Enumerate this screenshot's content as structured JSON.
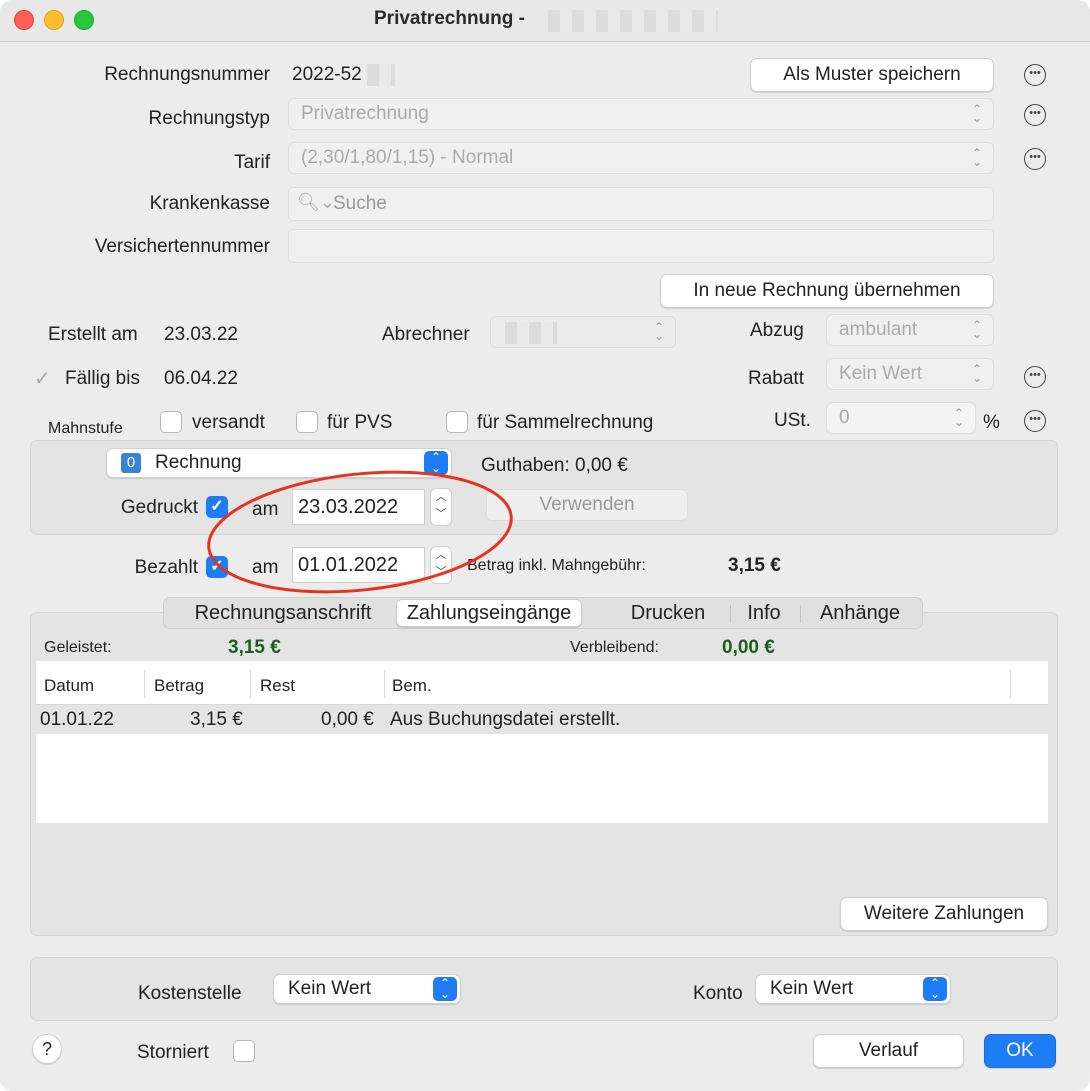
{
  "window": {
    "title": "Privatrechnung -"
  },
  "header": {
    "rechnungsnummer_label": "Rechnungsnummer",
    "rechnungsnummer_value": "2022-52",
    "save_pattern_button": "Als Muster speichern",
    "rechnungstyp_label": "Rechnungstyp",
    "rechnungstyp_value": "Privatrechnung",
    "tarif_label": "Tarif",
    "tarif_value": "(2,30/1,80/1,15) - Normal",
    "krankenkasse_label": "Krankenkasse",
    "krankenkasse_placeholder": "Suche",
    "versichertennummer_label": "Versichertennummer",
    "transfer_button": "In neue Rechnung übernehmen"
  },
  "details": {
    "erstellt_label": "Erstellt am",
    "erstellt_value": "23.03.22",
    "abrechner_label": "Abrechner",
    "abzug_label": "Abzug",
    "abzug_value": "ambulant",
    "faellig_label": "Fällig bis",
    "faellig_value": "06.04.22",
    "rabatt_label": "Rabatt",
    "rabatt_value": "Kein Wert",
    "mahnstufe_label": "Mahnstufe",
    "versandt_label": "versandt",
    "pvs_label": "für PVS",
    "sammel_label": "für Sammelrechnung",
    "ust_label": "USt.",
    "ust_value": "0",
    "percent": "%"
  },
  "status": {
    "badge": "0",
    "rechnung_value": "Rechnung",
    "guthaben": "Guthaben: 0,00 €",
    "gedruckt_label": "Gedruckt",
    "am_label": "am",
    "gedruckt_date": "23.03.2022",
    "verwenden_button": "Verwenden",
    "bezahlt_label": "Bezahlt",
    "bezahlt_date": "01.01.2022",
    "betrag_label": "Betrag inkl. Mahngebühr:",
    "betrag_value": "3,15 €"
  },
  "tabs": [
    {
      "label": "Rechnungsanschrift"
    },
    {
      "label": "Zahlungseingänge"
    },
    {
      "label": "Drucken"
    },
    {
      "label": "Info"
    },
    {
      "label": "Anhänge"
    }
  ],
  "payments": {
    "geleistet_label": "Geleistet:",
    "geleistet_value": "3,15 €",
    "verbleibend_label": "Verbleibend:",
    "verbleibend_value": "0,00 €",
    "columns": [
      "Datum",
      "Betrag",
      "Rest",
      "Bem."
    ],
    "rows": [
      {
        "datum": "01.01.22",
        "betrag": "3,15 €",
        "rest": "0,00 €",
        "bem": "Aus Buchungsdatei erstellt."
      }
    ],
    "more_button": "Weitere Zahlungen"
  },
  "footer": {
    "kostenstelle_label": "Kostenstelle",
    "kostenstelle_value": "Kein Wert",
    "konto_label": "Konto",
    "konto_value": "Kein Wert",
    "help": "?",
    "storniert_label": "Storniert",
    "verlauf_button": "Verlauf",
    "ok_button": "OK"
  },
  "colors": {
    "accent": "#1e7cf5",
    "annotation": "#e8321e",
    "positive": "#1d5e1d"
  }
}
